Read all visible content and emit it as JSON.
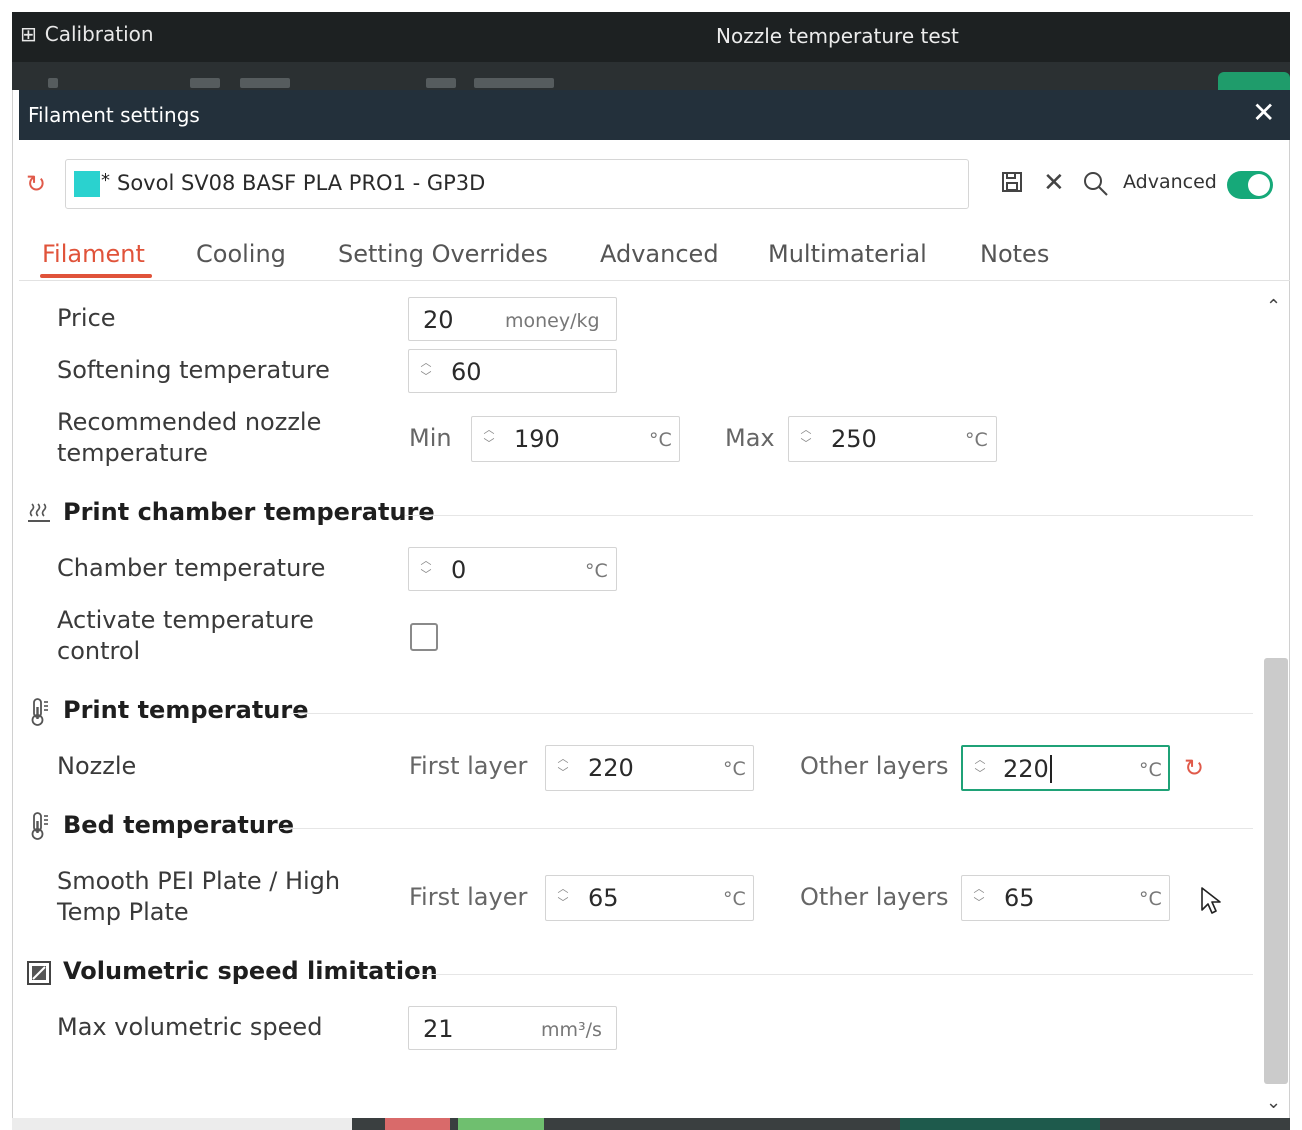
{
  "app": {
    "title_left": "Calibration",
    "title_center": "Nozzle temperature test"
  },
  "dialog": {
    "title": "Filament settings",
    "close_glyph": "✕"
  },
  "preset": {
    "name": "Sovol SV08 BASF PLA PRO1 - GP3D",
    "modified_marker": "*",
    "swatch_color": "#2ad2cf",
    "advanced_label": "Advanced",
    "advanced_on": true
  },
  "tabs": [
    {
      "label": "Filament",
      "active": true
    },
    {
      "label": "Cooling"
    },
    {
      "label": "Setting Overrides"
    },
    {
      "label": "Advanced"
    },
    {
      "label": "Multimaterial"
    },
    {
      "label": "Notes"
    }
  ],
  "fields": {
    "price": {
      "label": "Price",
      "value": "20",
      "unit": "money/kg"
    },
    "softening": {
      "label": "Softening temperature",
      "value": "60"
    },
    "recommended_nozzle": {
      "label_line1": "Recommended nozzle",
      "label_line2": "temperature",
      "min_label": "Min",
      "min_value": "190",
      "min_unit": "°C",
      "max_label": "Max",
      "max_value": "250",
      "max_unit": "°C"
    }
  },
  "sections": {
    "chamber": {
      "title": "Print chamber temperature",
      "chamber_temp": {
        "label": "Chamber temperature",
        "value": "0",
        "unit": "°C"
      },
      "activate": {
        "label_line1": "Activate temperature",
        "label_line2": "control",
        "checked": false
      }
    },
    "print_temp": {
      "title": "Print temperature",
      "nozzle": {
        "label": "Nozzle",
        "first_label": "First layer",
        "first_value": "220",
        "first_unit": "°C",
        "other_label": "Other layers",
        "other_value": "220",
        "other_unit": "°C"
      }
    },
    "bed_temp": {
      "title": "Bed temperature",
      "plate": {
        "label_line1": "Smooth PEI Plate / High",
        "label_line2": "Temp Plate",
        "first_label": "First layer",
        "first_value": "65",
        "first_unit": "°C",
        "other_label": "Other layers",
        "other_value": "65",
        "other_unit": "°C"
      }
    },
    "volumetric": {
      "title": "Volumetric speed limitation",
      "max_speed": {
        "label": "Max volumetric speed",
        "value": "21",
        "unit": "mm³/s"
      }
    }
  },
  "colors": {
    "accent": "#1fa277",
    "tab_active": "#e0533a",
    "dialog_titlebar": "#23303b"
  }
}
